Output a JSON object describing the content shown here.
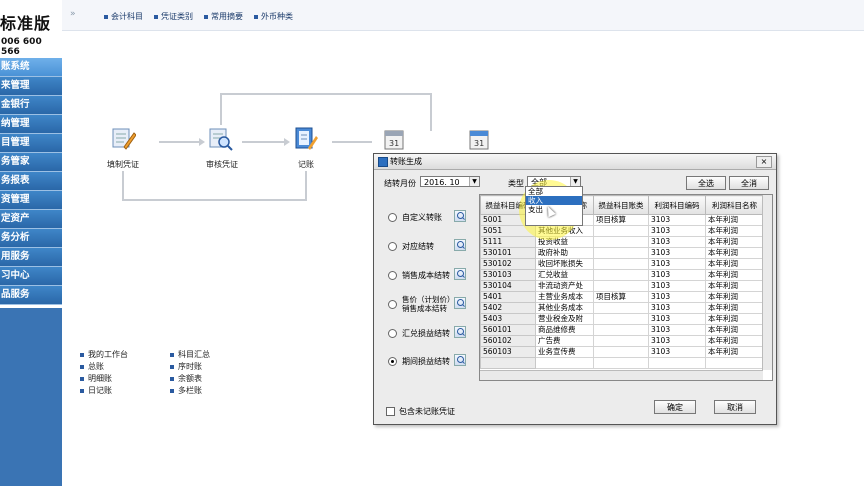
{
  "brand": {
    "title": "标准版",
    "phone": "006 600 566"
  },
  "sidebar": {
    "items": [
      {
        "label": "账系统",
        "active": true
      },
      {
        "label": "来管理"
      },
      {
        "label": "金银行"
      },
      {
        "label": "纳管理"
      },
      {
        "label": "目管理"
      },
      {
        "label": "务管家"
      },
      {
        "label": "务报表"
      },
      {
        "label": "资管理"
      },
      {
        "label": "定资产"
      },
      {
        "label": "务分析"
      },
      {
        "label": "用服务"
      },
      {
        "label": "习中心"
      },
      {
        "label": "品服务"
      }
    ]
  },
  "toolbar": {
    "arrows": "»",
    "links": [
      "会计科目",
      "凭证类别",
      "常用摘要",
      "外币种类"
    ]
  },
  "flow": {
    "nodes": [
      {
        "label": "填制凭证",
        "icon": "voucher-entry-icon"
      },
      {
        "label": "审核凭证",
        "icon": "voucher-audit-icon"
      },
      {
        "label": "记账",
        "icon": "posting-icon"
      }
    ]
  },
  "bottom_links": {
    "col1": [
      "我的工作台",
      "总账",
      "明细账",
      "日记账"
    ],
    "col2": [
      "科目汇总",
      "序时账",
      "余额表",
      "多栏账"
    ]
  },
  "dialog": {
    "title": "转账生成",
    "close": "×",
    "period_label": "结转月份",
    "period_value": "2016. 10",
    "type_label": "类型",
    "type_value": "全部",
    "select_all": "全选",
    "clear_all": "全消",
    "options": [
      {
        "label": "自定义转账",
        "checked": false
      },
      {
        "label": "对应结转",
        "checked": false
      },
      {
        "label": "销售成本结转",
        "checked": false
      },
      {
        "label": "售价（计划价）销售成本结转",
        "checked": false
      },
      {
        "label": "汇兑损益结转",
        "checked": false
      },
      {
        "label": "期间损益结转",
        "checked": true
      }
    ],
    "grid": {
      "columns": [
        "损益科目编码",
        "损益科目名称",
        "损益科目账类",
        "利润科目编码",
        "利润科目名称"
      ],
      "rows": [
        [
          "5001",
          "主营业务收入",
          "项目核算",
          "3103",
          "本年利润"
        ],
        [
          "5051",
          "其他业务收入",
          "",
          "3103",
          "本年利润"
        ],
        [
          "5111",
          "投资收益",
          "",
          "3103",
          "本年利润"
        ],
        [
          "530101",
          "政府补助",
          "",
          "3103",
          "本年利润"
        ],
        [
          "530102",
          "收回坏账损失",
          "",
          "3103",
          "本年利润"
        ],
        [
          "530103",
          "汇兑收益",
          "",
          "3103",
          "本年利润"
        ],
        [
          "530104",
          "非流动资产处",
          "",
          "3103",
          "本年利润"
        ],
        [
          "5401",
          "主营业务成本",
          "项目核算",
          "3103",
          "本年利润"
        ],
        [
          "5402",
          "其他业务成本",
          "",
          "3103",
          "本年利润"
        ],
        [
          "5403",
          "营业税金及附",
          "",
          "3103",
          "本年利润"
        ],
        [
          "560101",
          "商品维修费",
          "",
          "3103",
          "本年利润"
        ],
        [
          "560102",
          "广告费",
          "",
          "3103",
          "本年利润"
        ],
        [
          "560103",
          "业务宣传费",
          "",
          "3103",
          "本年利润"
        ],
        [
          "",
          "",
          "",
          "",
          ""
        ]
      ]
    },
    "type_options": [
      "全部",
      "收入",
      "支出"
    ],
    "include_unposted": "包含未记账凭证",
    "ok": "确定",
    "cancel": "取消"
  }
}
